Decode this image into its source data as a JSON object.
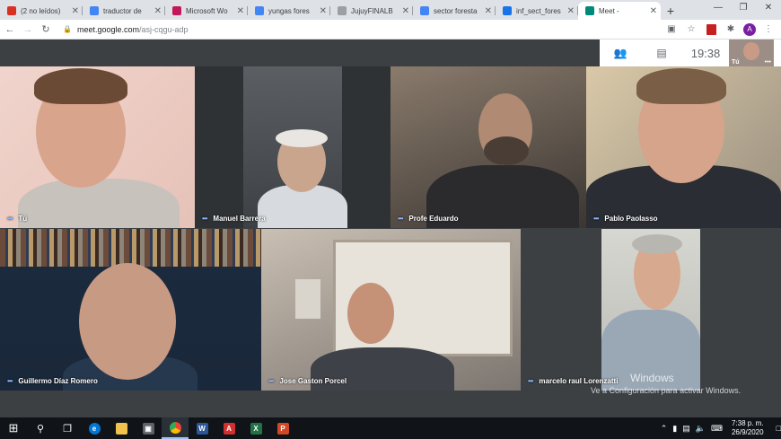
{
  "browser": {
    "tabs": [
      {
        "title": "(2 no leídos)",
        "favicon": "gmail-icon",
        "color": "#d93025",
        "active": false
      },
      {
        "title": "traductor de",
        "favicon": "google-icon",
        "color": "#4285f4",
        "active": false
      },
      {
        "title": "Microsoft Wo",
        "favicon": "microsoft-word-icon",
        "color": "#c2185b",
        "active": false
      },
      {
        "title": "yungas fores",
        "favicon": "google-icon",
        "color": "#4285f4",
        "active": false
      },
      {
        "title": "JujuyFINALB",
        "favicon": "page-icon",
        "color": "#9aa0a6",
        "active": false
      },
      {
        "title": "sector foresta",
        "favicon": "google-icon",
        "color": "#4285f4",
        "active": false
      },
      {
        "title": "inf_sect_fores",
        "favicon": "link-icon",
        "color": "#1a73e8",
        "active": false
      },
      {
        "title": "Meet - ",
        "favicon": "meet-icon",
        "color": "#00897b",
        "active": true
      }
    ],
    "new_tab": "+",
    "url_host": "meet.google.com",
    "url_path": "/asj-cqgu-adp"
  },
  "meet": {
    "time": "19:38",
    "self_label": "Tú",
    "participants": [
      {
        "name": "Tú"
      },
      {
        "name": "Manuel Barrera"
      },
      {
        "name": "Profe Eduardo"
      },
      {
        "name": "Pablo Paolasso"
      },
      {
        "name": "Guillermo Díaz Romero"
      },
      {
        "name": "Jose Gaston Porcel"
      },
      {
        "name": "marcelo raul Lorenzatti"
      }
    ]
  },
  "windows_activation": {
    "title": "Windows",
    "message": "Ve a Configuración para activar Windows."
  },
  "taskbar": {
    "time": "7:38 p. m.",
    "date": "26/9/2020"
  },
  "colors": {
    "meet_bg": "#3c4043",
    "accent_dots": "#8ab4f8",
    "taskbar": "#101418"
  }
}
